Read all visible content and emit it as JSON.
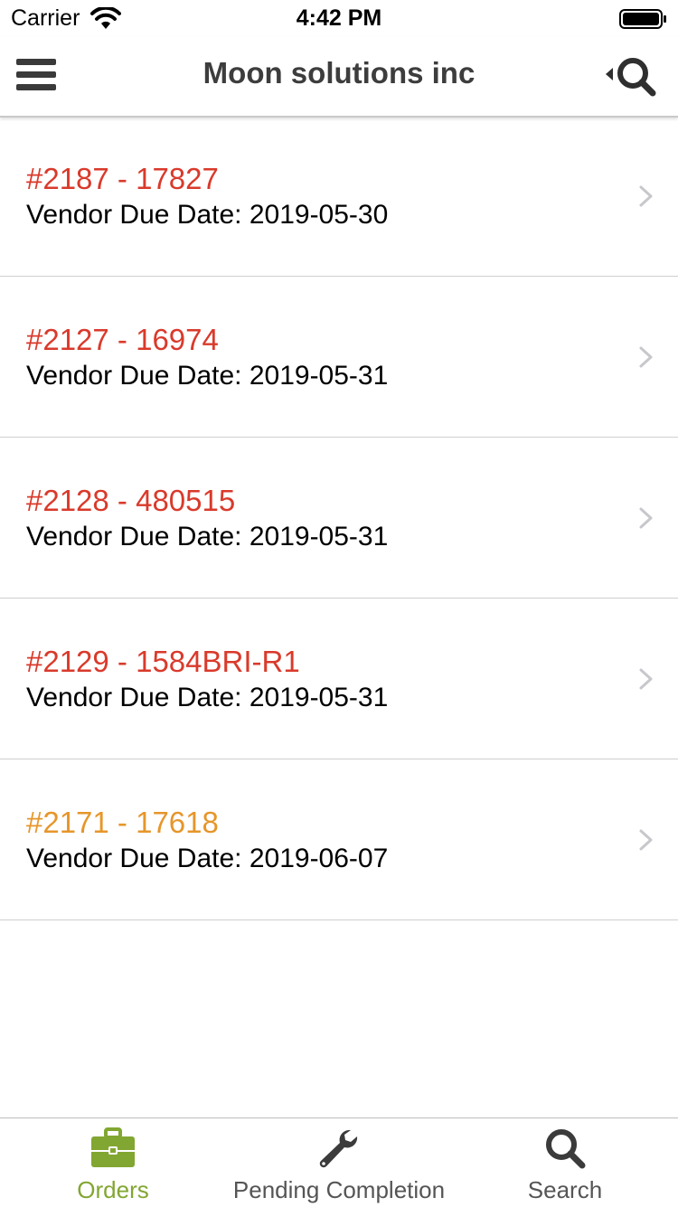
{
  "status_bar": {
    "carrier": "Carrier",
    "time": "4:42 PM"
  },
  "nav": {
    "title": "Moon solutions inc",
    "menu_icon": "hamburger-icon",
    "search_toggle_icon": "search-collapse-icon"
  },
  "colors": {
    "overdue": "#d93a2b",
    "upcoming": "#e6962a",
    "tab_active": "#82a632",
    "tab_inactive": "#555555"
  },
  "orders": [
    {
      "title": "#2187 - 17827",
      "date_label": "Vendor Due Date: 2019-05-30",
      "status": "overdue"
    },
    {
      "title": "#2127 - 16974",
      "date_label": "Vendor Due Date: 2019-05-31",
      "status": "overdue"
    },
    {
      "title": "#2128 - 480515",
      "date_label": "Vendor Due Date: 2019-05-31",
      "status": "overdue"
    },
    {
      "title": "#2129 - 1584BRI-R1",
      "date_label": "Vendor Due Date: 2019-05-31",
      "status": "overdue"
    },
    {
      "title": "#2171 - 17618",
      "date_label": "Vendor Due Date: 2019-06-07",
      "status": "upcoming"
    }
  ],
  "tabs": [
    {
      "label": "Orders",
      "icon": "briefcase-icon",
      "active": true
    },
    {
      "label": "Pending Completion",
      "icon": "wrench-icon",
      "active": false
    },
    {
      "label": "Search",
      "icon": "search-icon",
      "active": false
    }
  ]
}
